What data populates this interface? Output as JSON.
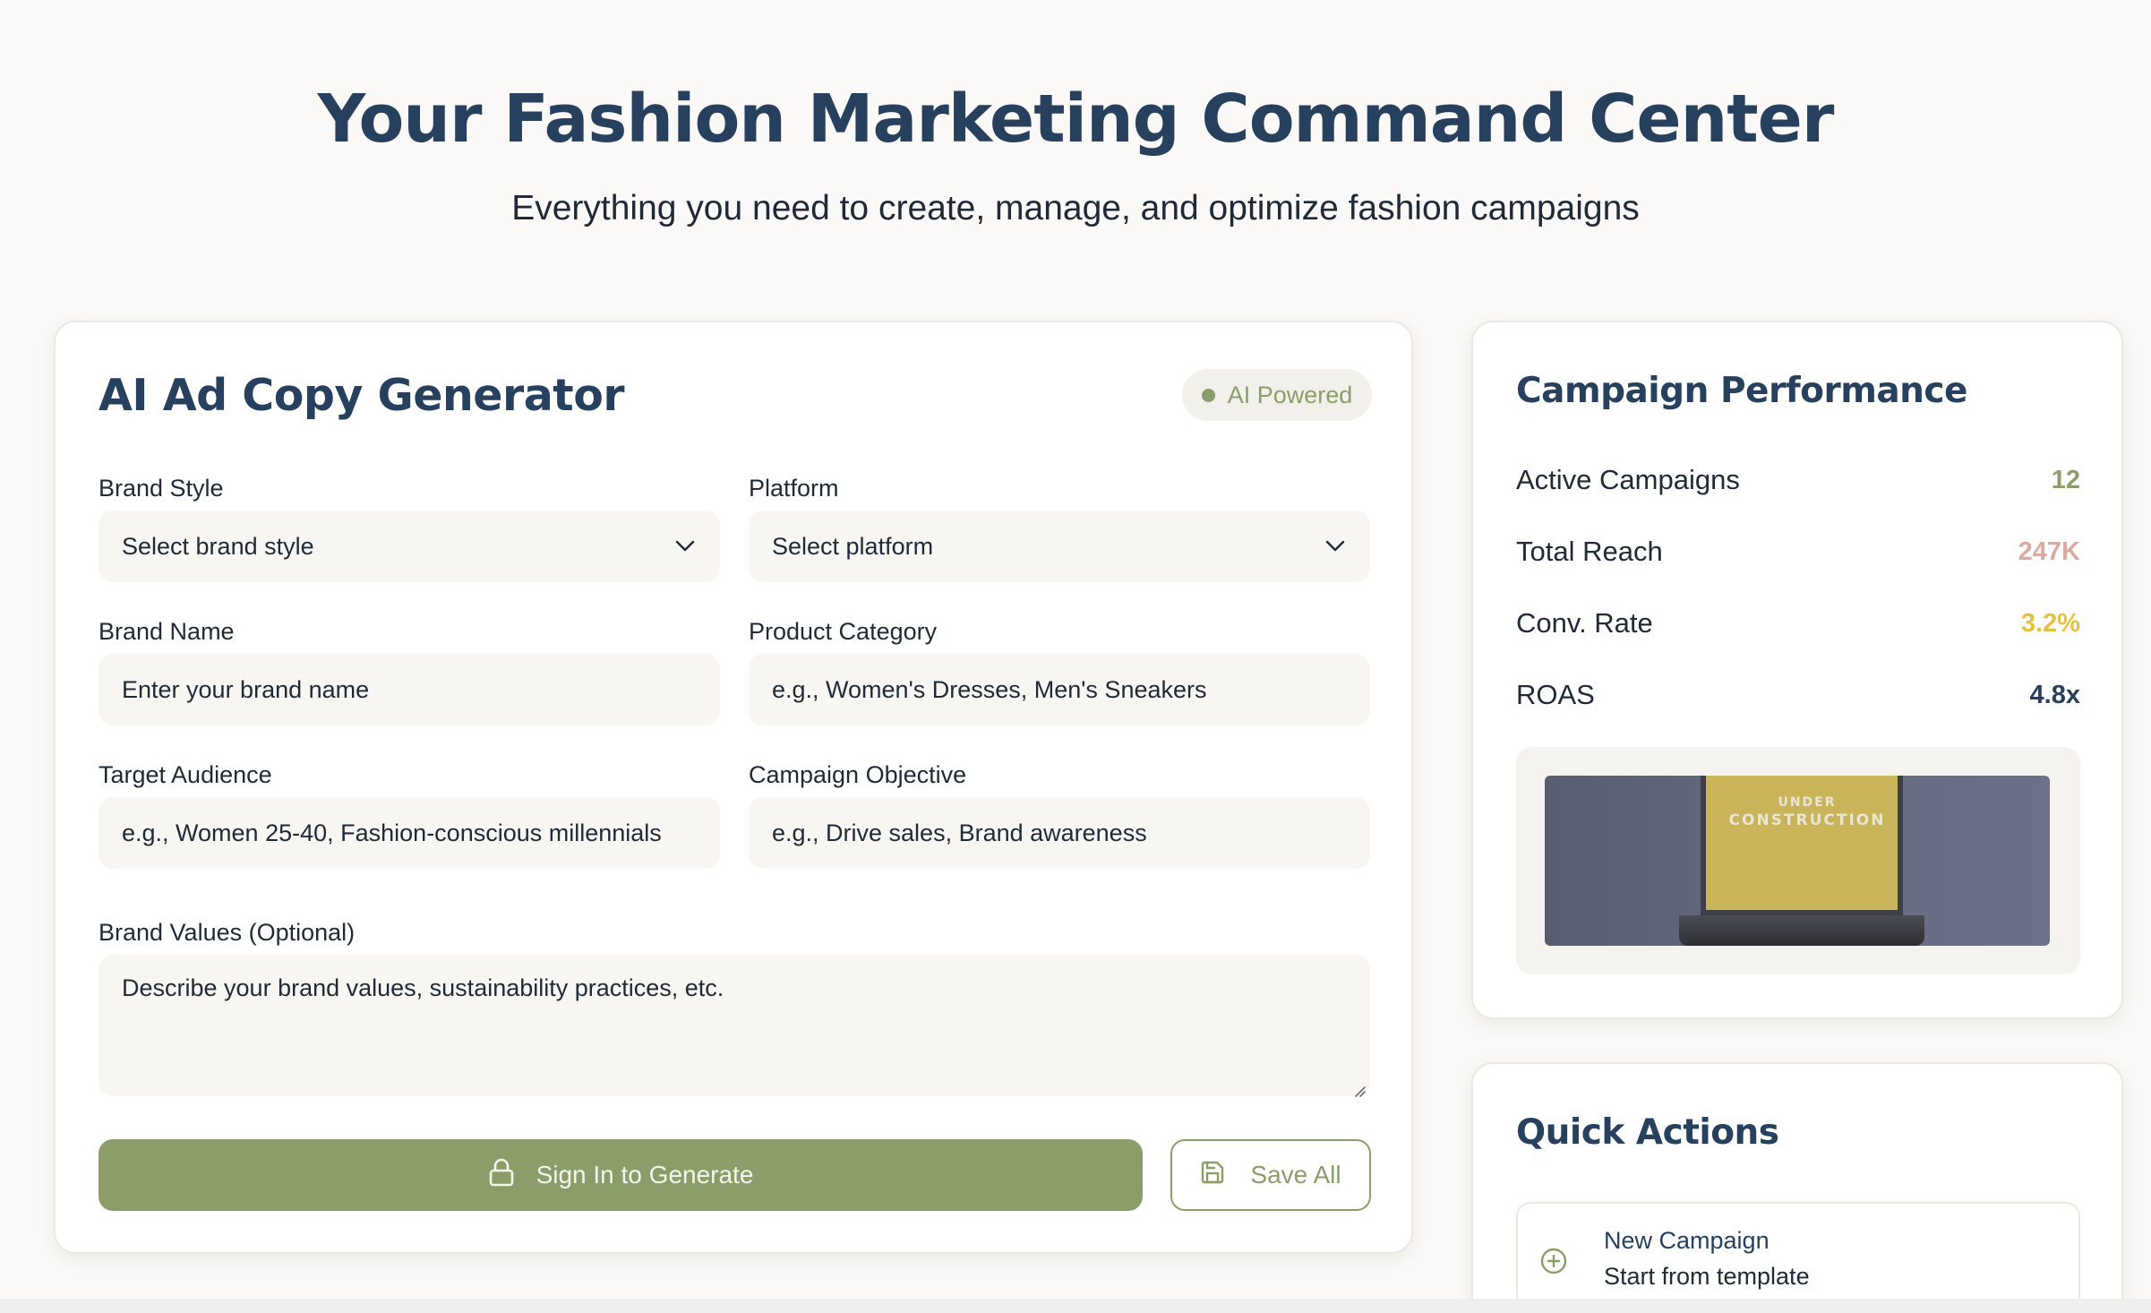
{
  "hero": {
    "title": "Your Fashion Marketing Command Center",
    "subtitle": "Everything you need to create, manage, and optimize fashion campaigns"
  },
  "generator": {
    "title": "AI Ad Copy Generator",
    "badge": "AI Powered",
    "fields": {
      "brand_style": {
        "label": "Brand Style",
        "value": "Select brand style"
      },
      "platform": {
        "label": "Platform",
        "value": "Select platform"
      },
      "brand_name": {
        "label": "Brand Name",
        "placeholder": "Enter your brand name"
      },
      "product_category": {
        "label": "Product Category",
        "placeholder": "e.g., Women's Dresses, Men's Sneakers"
      },
      "target_audience": {
        "label": "Target Audience",
        "placeholder": "e.g., Women 25-40, Fashion-conscious millennials"
      },
      "campaign_objective": {
        "label": "Campaign Objective",
        "placeholder": "e.g., Drive sales, Brand awareness"
      },
      "brand_values": {
        "label": "Brand Values (Optional)",
        "placeholder": "Describe your brand values, sustainability practices, etc."
      }
    },
    "primary_button": "Sign In to Generate",
    "secondary_button": "Save All"
  },
  "performance": {
    "title": "Campaign Performance",
    "metrics": [
      {
        "label": "Active Campaigns",
        "value": "12",
        "color": "#8b9e6a"
      },
      {
        "label": "Total Reach",
        "value": "247K",
        "color": "#d7ab9f"
      },
      {
        "label": "Conv. Rate",
        "value": "3.2%",
        "color": "#e3c23f"
      },
      {
        "label": "ROAS",
        "value": "4.8x",
        "color": "#26405e"
      }
    ],
    "image_text": {
      "line1": "UNDER",
      "line2": "CONSTRUCTION"
    }
  },
  "quick_actions": {
    "title": "Quick Actions",
    "items": [
      {
        "name": "New Campaign",
        "description": "Start from template",
        "icon": "plus-circle-icon"
      }
    ]
  },
  "colors": {
    "accent": "#8b9e6a",
    "heading": "#26405e",
    "background": "#faf9f7"
  }
}
